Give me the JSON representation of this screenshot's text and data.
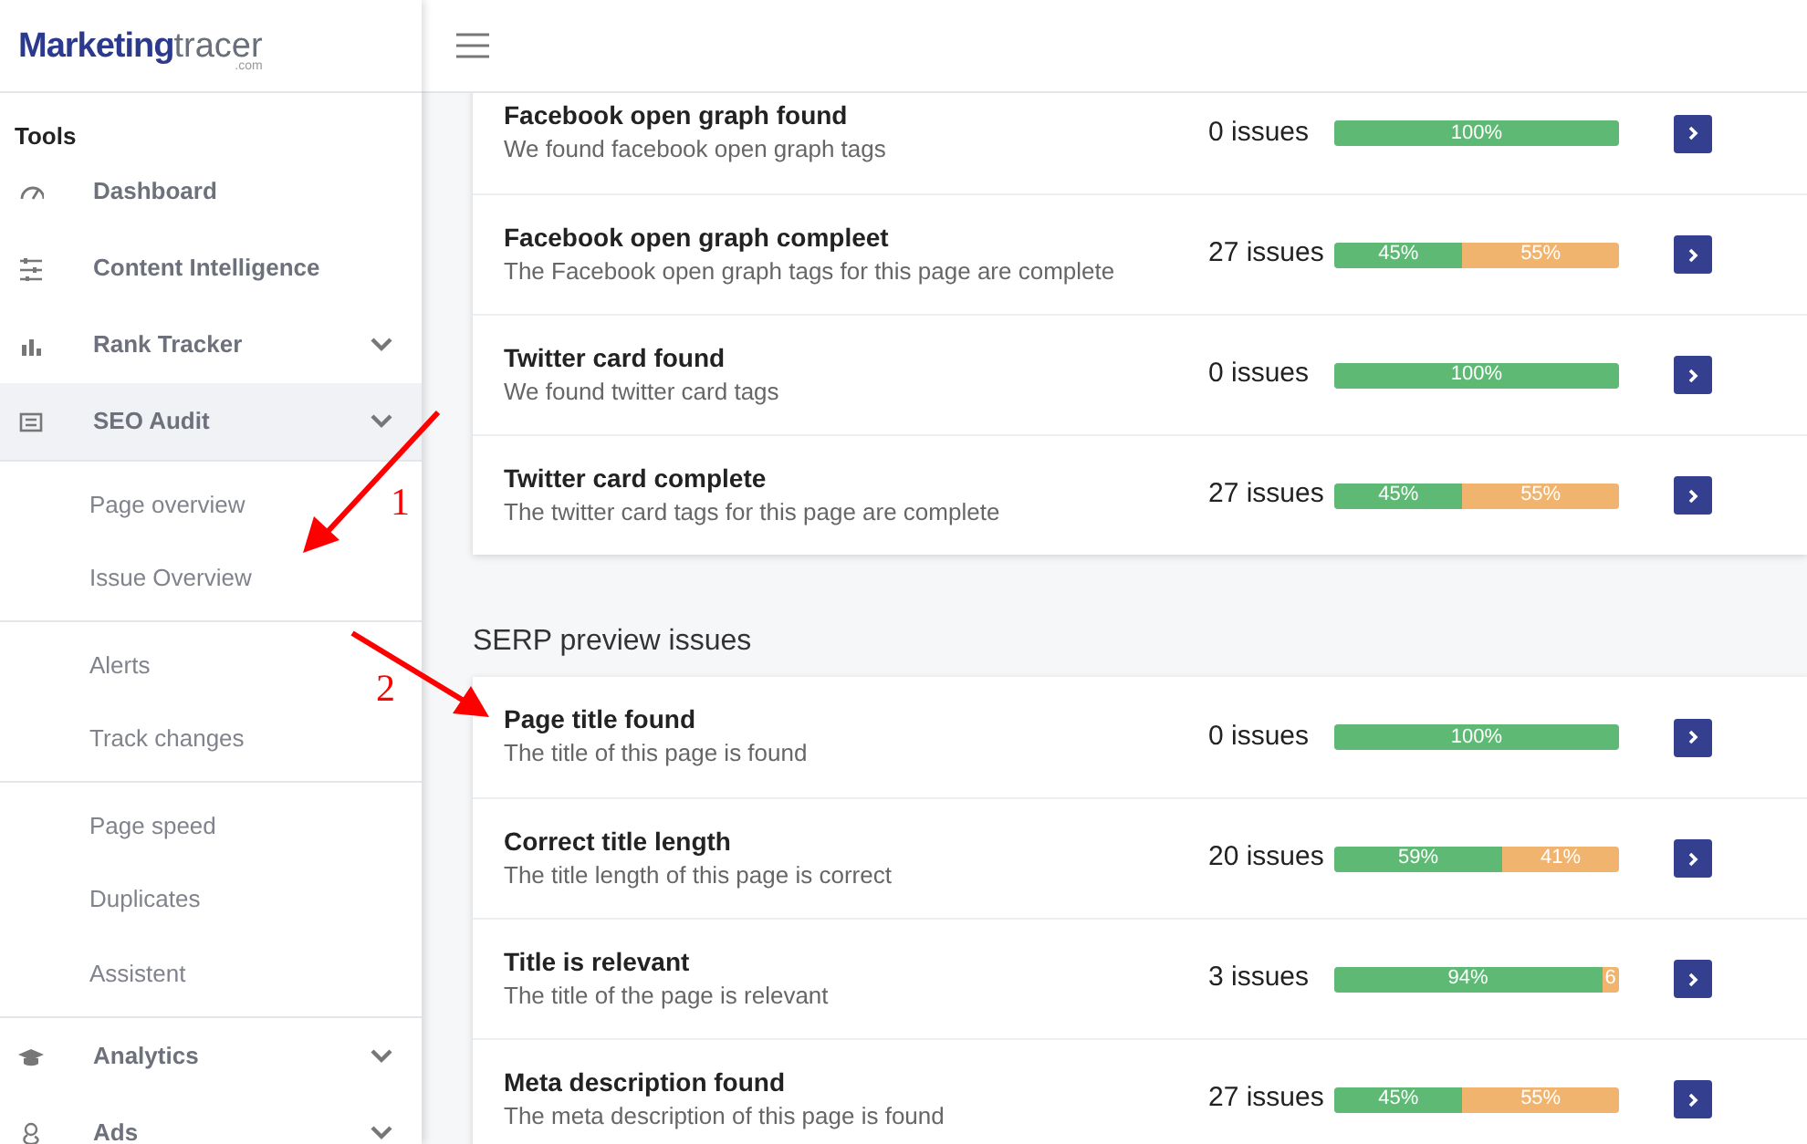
{
  "logo": {
    "brand": "Marketing",
    "brand_light": "tracer",
    "suffix": ".com"
  },
  "sidebar": {
    "heading": "Tools",
    "items": [
      {
        "label": "Dashboard",
        "kind": "link"
      },
      {
        "label": "Content Intelligence",
        "kind": "link"
      },
      {
        "label": "Rank Tracker",
        "kind": "menu",
        "expanded": false
      },
      {
        "label": "SEO Audit",
        "kind": "menu",
        "expanded": true,
        "children": [
          {
            "items": [
              {
                "label": "Page overview"
              },
              {
                "label": "Issue Overview"
              }
            ]
          },
          {
            "items": [
              {
                "label": "Alerts"
              },
              {
                "label": "Track changes"
              }
            ]
          },
          {
            "items": [
              {
                "label": "Page speed"
              },
              {
                "label": "Duplicates"
              },
              {
                "label": "Assistent"
              }
            ]
          }
        ]
      },
      {
        "label": "Analytics",
        "kind": "menu",
        "expanded": false
      },
      {
        "label": "Ads",
        "kind": "menu",
        "expanded": false
      }
    ]
  },
  "sections": [
    {
      "rows": [
        {
          "title": "Facebook open graph found",
          "description": "We found facebook open graph tags",
          "issues": "0 issues",
          "segments": [
            {
              "kind": "pass",
              "level": 1,
              "label": "100%"
            }
          ]
        },
        {
          "title": "Facebook open graph compleet",
          "description": "The Facebook open graph tags for this page are complete",
          "issues": "27 issues",
          "segments": [
            {
              "kind": "pass",
              "level": 0.45,
              "label": "45%"
            },
            {
              "kind": "fail",
              "level": 0.55,
              "label": "55%"
            }
          ]
        },
        {
          "title": "Twitter card found",
          "description": "We found twitter card tags",
          "issues": "0 issues",
          "segments": [
            {
              "kind": "pass",
              "level": 1,
              "label": "100%"
            }
          ]
        },
        {
          "title": "Twitter card complete",
          "description": "The twitter card tags for this page are complete",
          "issues": "27 issues",
          "segments": [
            {
              "kind": "pass",
              "level": 0.45,
              "label": "45%"
            },
            {
              "kind": "fail",
              "level": 0.55,
              "label": "55%"
            }
          ]
        }
      ]
    },
    {
      "heading": "SERP preview issues",
      "rows": [
        {
          "title": "Page title found",
          "description": "The title of this page is found",
          "issues": "0 issues",
          "segments": [
            {
              "kind": "pass",
              "level": 1,
              "label": "100%"
            }
          ]
        },
        {
          "title": "Correct title length",
          "description": "The title length of this page is correct",
          "issues": "20 issues",
          "segments": [
            {
              "kind": "pass",
              "level": 0.59,
              "label": "59%"
            },
            {
              "kind": "fail",
              "level": 0.41,
              "label": "41%"
            }
          ]
        },
        {
          "title": "Title is relevant",
          "description": "The title of the page is relevant",
          "issues": "3 issues",
          "segments": [
            {
              "kind": "pass",
              "level": 0.94,
              "label": "94%"
            },
            {
              "kind": "fail",
              "level": 0.06,
              "label": "6"
            }
          ]
        },
        {
          "title": "Meta description found",
          "description": "The meta description of this page is found",
          "issues": "27 issues",
          "segments": [
            {
              "kind": "pass",
              "level": 0.45,
              "label": "45%"
            },
            {
              "kind": "fail",
              "level": 0.55,
              "label": "55%"
            }
          ]
        }
      ]
    }
  ],
  "annotations": [
    {
      "label": "1"
    },
    {
      "label": "2"
    }
  ]
}
